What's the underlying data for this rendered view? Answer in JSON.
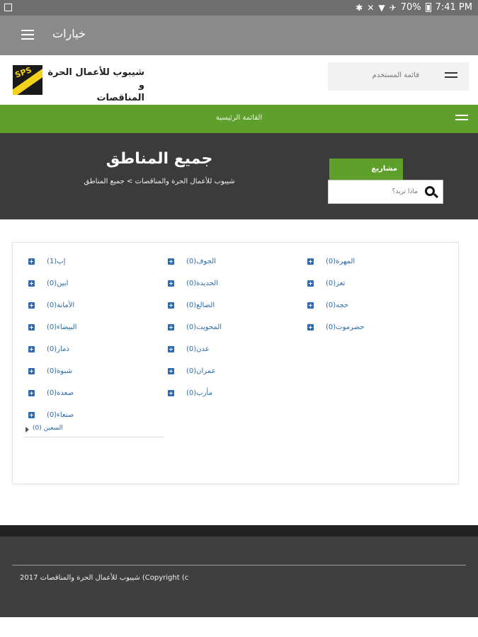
{
  "status_bar": {
    "battery": "70%",
    "time": "7:41 PM"
  },
  "app_bar": {
    "title": "خيارات"
  },
  "header": {
    "brand_line1": "شيبوب للأعمال الحرة و",
    "brand_line2": "المناقصات",
    "user_menu_label": "قائمة المستخدم"
  },
  "main_menu": {
    "label": "القائمة الرئيسية"
  },
  "hero": {
    "title": "جميع المناطق",
    "breadcrumb": "شيبوب للأعمال الحرة والمناقصات > جميع المناطق",
    "projects_tab": "مشاريع",
    "search_placeholder": "ماذا تريد؟"
  },
  "regions": {
    "col1": [
      "إب(1)",
      "ابين(0)",
      "الأمانة(0)",
      "البيضاء(0)",
      "ذمار(0)",
      "شبوة(0)",
      "صعدة(0)",
      "صنعاء(0)"
    ],
    "col2": [
      "الجوف(0)",
      "الحديدة(0)",
      "الضالع(0)",
      "المحويت(0)",
      "عدن(0)",
      "عمران(0)",
      "مأرب(0)"
    ],
    "col3": [
      "المهرة(0)",
      "تعز(0)",
      "حجه(0)",
      "حضرموت(0)"
    ],
    "more_label": "السعين (0)"
  },
  "footer": {
    "copyright": "2017 شيبوب للأعمال الحرة والمناقصات (Copyright (c"
  }
}
